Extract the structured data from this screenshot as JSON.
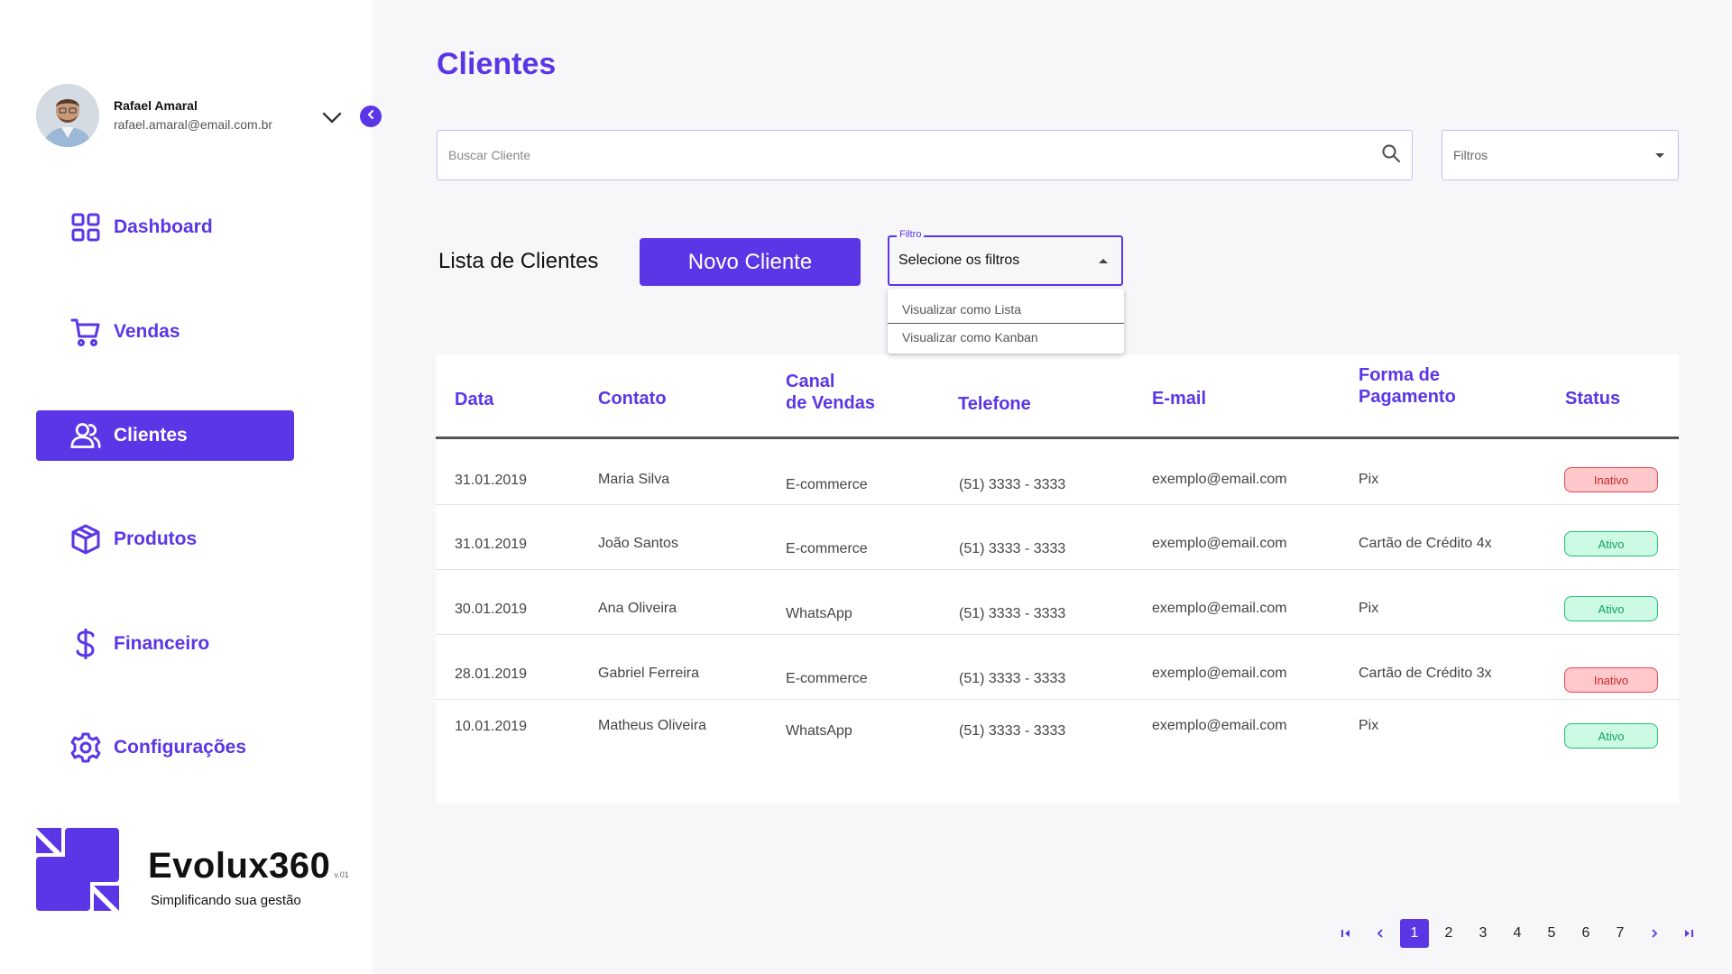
{
  "profile": {
    "name": "Rafael Amaral",
    "email": "rafael.amaral@email.com.br"
  },
  "sidebar": {
    "items": [
      {
        "label": "Dashboard",
        "icon": "grid-icon",
        "active": false
      },
      {
        "label": "Vendas",
        "icon": "cart-icon",
        "active": false
      },
      {
        "label": "Clientes",
        "icon": "users-icon",
        "active": true
      },
      {
        "label": "Produtos",
        "icon": "box-icon",
        "active": false
      },
      {
        "label": "Financeiro",
        "icon": "dollar-icon",
        "active": false
      },
      {
        "label": "Configurações",
        "icon": "gear-icon",
        "active": false
      }
    ]
  },
  "brand": {
    "name": "Evolux360",
    "version": "v.01",
    "tagline": "Simplificando sua gestão"
  },
  "page": {
    "title": "Clientes"
  },
  "search": {
    "placeholder": "Buscar Cliente"
  },
  "filters": {
    "label": "Filtros"
  },
  "list": {
    "title": "Lista de Clientes",
    "new_button": "Novo Cliente",
    "filter": {
      "legend": "Filtro",
      "value": "Selecione os filtros",
      "options": [
        "Visualizar como Lista",
        "Visualizar como Kanban"
      ]
    }
  },
  "table": {
    "headers": {
      "data": "Data",
      "contato": "Contato",
      "canal_1": "Canal",
      "canal_2": "de Vendas",
      "telefone": "Telefone",
      "email": "E-mail",
      "pagamento_1": "Forma de",
      "pagamento_2": "Pagamento",
      "status": "Status"
    },
    "rows": [
      {
        "data": "31.01.2019",
        "contato": "Maria Silva",
        "canal": "E-commerce",
        "telefone": "(51) 3333 - 3333",
        "email": "exemplo@email.com",
        "pagamento": "Pix",
        "status": "Inativo"
      },
      {
        "data": "31.01.2019",
        "contato": "João Santos",
        "canal": "E-commerce",
        "telefone": "(51) 3333 - 3333",
        "email": "exemplo@email.com",
        "pagamento": "Cartão de Crédito 4x",
        "status": "Ativo"
      },
      {
        "data": "30.01.2019",
        "contato": "Ana Oliveira",
        "canal": "WhatsApp",
        "telefone": "(51) 3333 - 3333",
        "email": "exemplo@email.com",
        "pagamento": "Pix",
        "status": "Ativo"
      },
      {
        "data": "28.01.2019",
        "contato": "Gabriel Ferreira",
        "canal": "E-commerce",
        "telefone": "(51) 3333 - 3333",
        "email": "exemplo@email.com",
        "pagamento": "Cartão de Crédito 3x",
        "status": "Inativo"
      },
      {
        "data": "10.01.2019",
        "contato": "Matheus Oliveira",
        "canal": "WhatsApp",
        "telefone": "(51) 3333 - 3333",
        "email": "exemplo@email.com",
        "pagamento": "Pix",
        "status": "Ativo"
      }
    ]
  },
  "pagination": {
    "pages": [
      "1",
      "2",
      "3",
      "4",
      "5",
      "6",
      "7"
    ],
    "current": "1"
  },
  "colors": {
    "accent": "#5b36e7",
    "inactive": "#e2474f",
    "active": "#1fbf74"
  }
}
